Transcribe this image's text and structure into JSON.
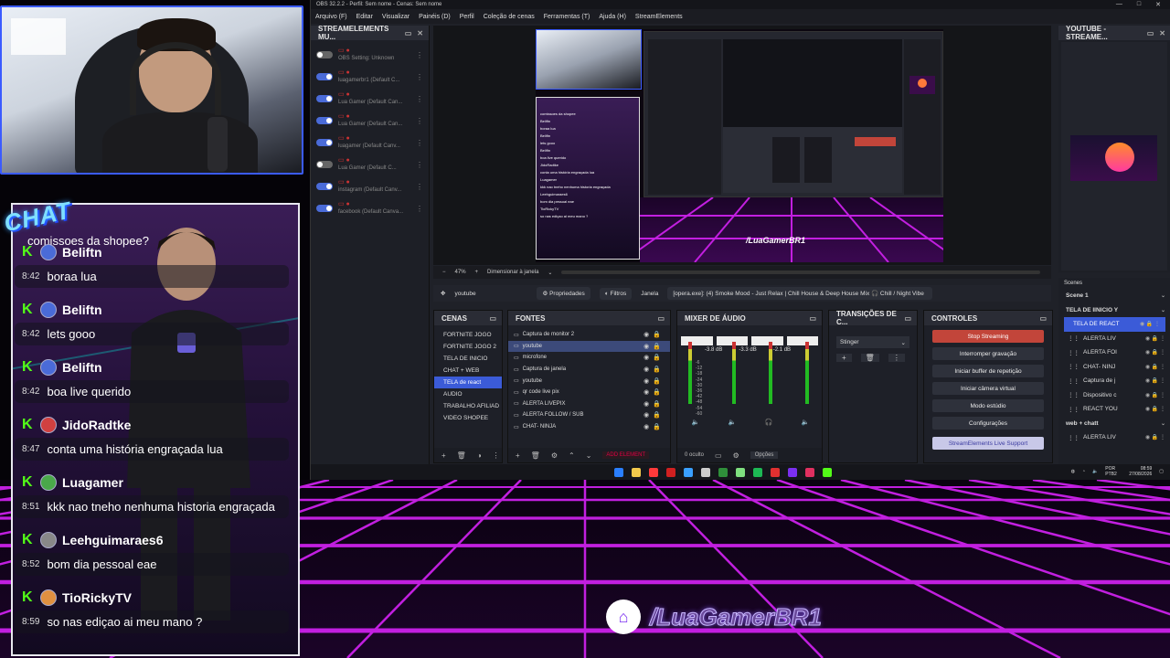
{
  "webcam": {
    "label": "webcam"
  },
  "chat": {
    "badge": "CHAT",
    "top_message": "comissoes da shopee?",
    "messages": [
      {
        "user": "Beliftn",
        "time": "8:42",
        "text": "boraa lua",
        "avatar": "blue"
      },
      {
        "user": "Beliftn",
        "time": "8:42",
        "text": "lets gooo",
        "avatar": "blue"
      },
      {
        "user": "Beliftn",
        "time": "8:42",
        "text": "boa live querido",
        "avatar": "blue"
      },
      {
        "user": "JidoRadtke",
        "time": "8:47",
        "text": "conta uma história engraçada lua",
        "avatar": "red"
      },
      {
        "user": "Luagamer",
        "time": "8:51",
        "text": "kkk nao tneho nenhuma historia engraçada",
        "avatar": "green"
      },
      {
        "user": "Leehguimaraes6",
        "time": "8:52",
        "text": "bom dia pessoal eae",
        "avatar": "grey"
      },
      {
        "user": "TioRickyTV",
        "time": "8:59",
        "text": "so nas ediçao ai meu mano ?",
        "avatar": "orange"
      }
    ]
  },
  "obs": {
    "title": "OBS 32.2.2 - Perfil: Sem nome - Cenas: Sem nome",
    "menu": [
      "Arquivo (F)",
      "Editar",
      "Visualizar",
      "Painéis (D)",
      "Perfil",
      "Coleção de cenas",
      "Ferramentas (T)",
      "Ajuda (H)",
      "StreamElements"
    ],
    "se_dock": {
      "title": "STREAMELEMENTS MU...",
      "items": [
        {
          "text": "OBS Setting: Unknown",
          "on": false
        },
        {
          "text": "luagamerbr1 (Default C...",
          "on": true
        },
        {
          "text": "Lua Gamer (Default Can...",
          "on": true
        },
        {
          "text": "Lua Gamer (Default Can...",
          "on": true
        },
        {
          "text": "luagamer (Default Canv...",
          "on": true
        },
        {
          "text": "Lua Gamer (Default C...",
          "on": false
        },
        {
          "text": "instagram (Default Canv...",
          "on": true
        },
        {
          "text": "facebook (Default Canva...",
          "on": true
        }
      ]
    },
    "preview": {
      "chat_lines": [
        "comissoes da shopee",
        "Beliftn",
        "boraa lua",
        "Beliftn",
        "lets gooo",
        "Beliftn",
        "boa live querido",
        "JidoRadtke",
        "conta uma história engraçada lua",
        "Luagamer",
        "kkk nao tneho nenhuma historia engraçada",
        "Leehguimaraes6",
        "bom dia pessoal eae",
        "TioRickyTV",
        "so nas ediçao ai meu mano ?"
      ],
      "logo": "/LuaGamerBR1"
    },
    "zoom": {
      "value": "47%",
      "mode": "Dimensionar à janela"
    },
    "source_bar": {
      "name": "youtube",
      "props": "Propriedades",
      "filters": "Filtros",
      "window_label": "Janela",
      "window_value": "[opera.exe]: (4) Smoke Mood - Just Relax | Chill House & Deep House Mix 🎧 Chill / Night Vibe"
    },
    "scenes": {
      "title": "CENAS",
      "items": [
        "FORTNITE JOGO",
        "FORTNITE JOGO 2",
        "TELA DE INICIO",
        "CHAT + WEB",
        "TELA de react",
        "AUDIO",
        "TRABALHO AFILIAD",
        "VIDEO SHOPEE"
      ],
      "selected": 4
    },
    "sources": {
      "title": "FONTES",
      "items": [
        "Captura de monitor 2",
        "youtube",
        "microfone",
        "Captura de janela",
        "youtube",
        "qr code live pix",
        "ALERTA LIVEPIX",
        "ALERTA FOLLOW / SUB",
        "CHAT- NINJA"
      ],
      "selected": 1,
      "add_label": "ADD ELEMENT"
    },
    "mixer": {
      "title": "MIXER DE ÁUDIO",
      "channels": [
        {
          "db": "-3.8 dB"
        },
        {
          "db": "-3.3 dB"
        },
        {
          "db": "-2.1 dB"
        }
      ],
      "hidden_label": "0 oculto",
      "options_label": "Opções",
      "scale": [
        "-6",
        "-12",
        "-18",
        "-24",
        "-30",
        "-36",
        "-42",
        "-48",
        "-54",
        "-60"
      ]
    },
    "transitions": {
      "title": "TRANSIÇÕES DE C...",
      "value": "Stinger"
    },
    "controls": {
      "title": "CONTROLES",
      "buttons": [
        "Stop Streaming",
        "Interromper gravação",
        "Iniciar buffer de repetição",
        "Iniciar câmera virtual",
        "Modo estúdio",
        "Configurações"
      ],
      "se_support": "StreamElements Live Support"
    },
    "youtube_dock": {
      "title": "YOUTUBE - STREAME..."
    },
    "scenes2": {
      "header": "Scenes",
      "rows": [
        {
          "text": "Scene 1",
          "type": "bold"
        },
        {
          "text": "TELA DE IINICIO Y",
          "type": "bold"
        },
        {
          "text": "TELA DE REACT",
          "type": "sel"
        },
        {
          "text": "ALERTA LIV",
          "type": "item"
        },
        {
          "text": "ALERTA FOI",
          "type": "item"
        },
        {
          "text": "CHAT- NINJ",
          "type": "item"
        },
        {
          "text": "Captura de j",
          "type": "item"
        },
        {
          "text": "Dispositivo c",
          "type": "item"
        },
        {
          "text": "REACT YOU",
          "type": "item"
        },
        {
          "text": "web + chatt",
          "type": "bold"
        },
        {
          "text": "ALERTA LIV",
          "type": "item"
        }
      ]
    },
    "taskbar": {
      "lang": "POR PTB2",
      "time": "08:59",
      "date": "27/08/2026"
    }
  },
  "brand": {
    "handle": "/LuaGamerBR1",
    "platform_icon": "twitch-icon"
  },
  "colors": {
    "accent": "#3b5bd8",
    "stop": "#c2453a",
    "kick": "#53fc18",
    "grid": "#c21fe0"
  }
}
